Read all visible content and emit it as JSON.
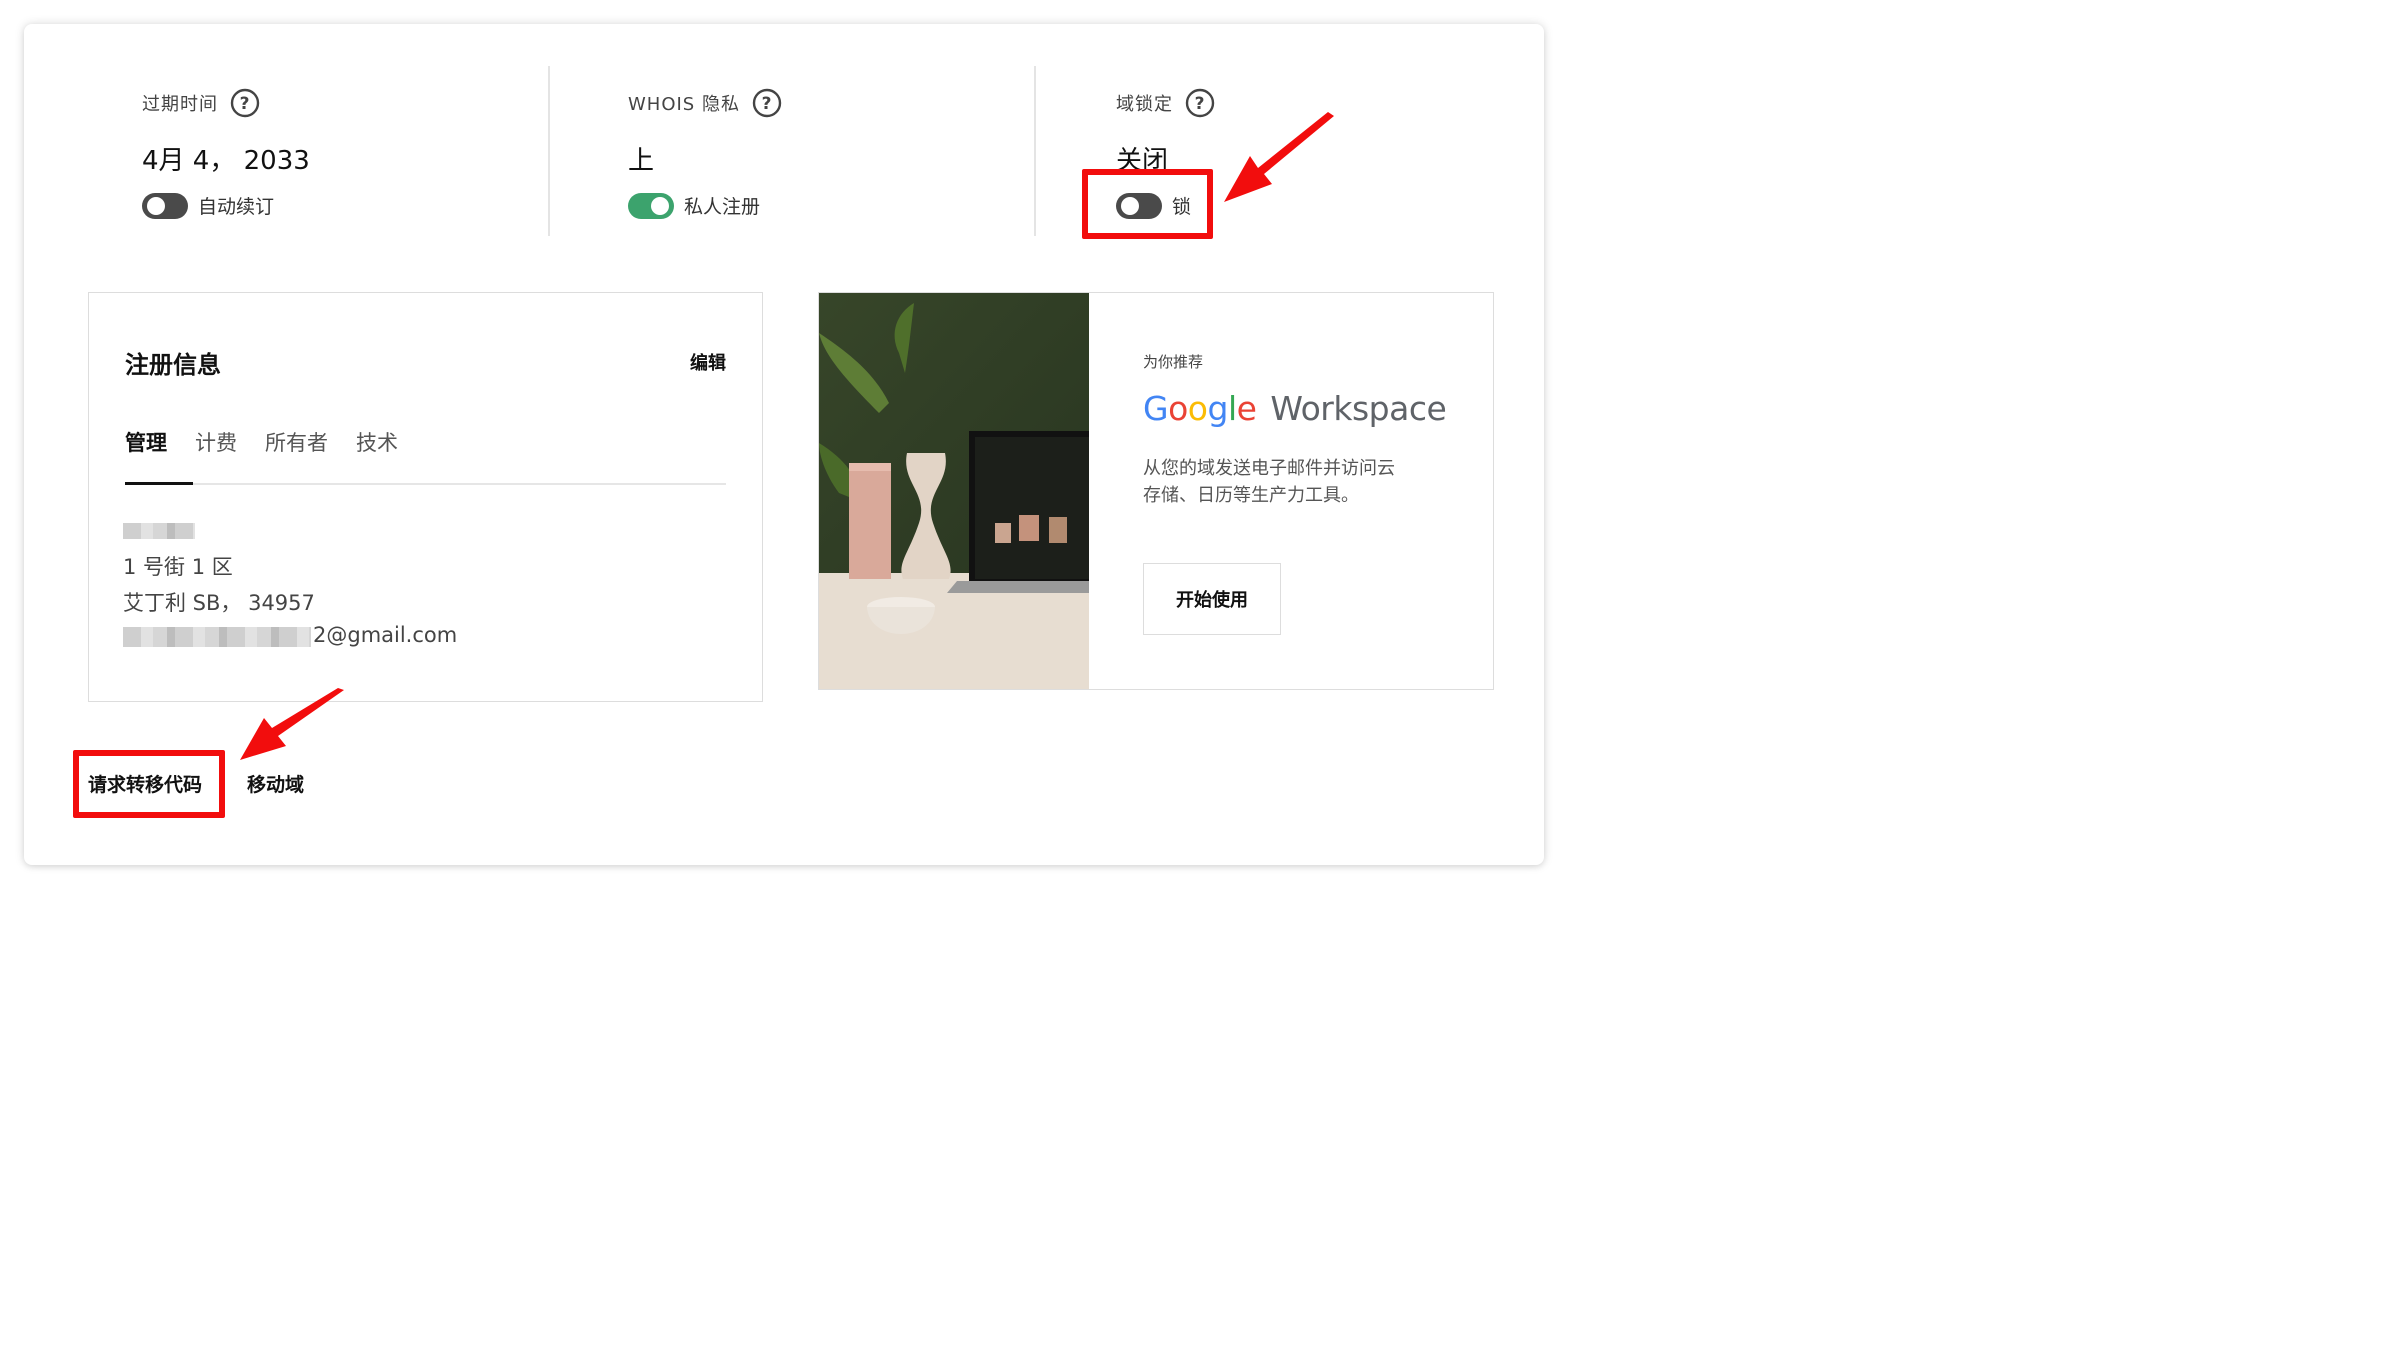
{
  "status_columns": [
    {
      "label": "过期时间",
      "value": "4月 4， 2033",
      "toggle_label": "自动续订",
      "toggle_on": false
    },
    {
      "label": "WHOIS 隐私",
      "value": "上",
      "toggle_label": "私人注册",
      "toggle_on": true
    },
    {
      "label": "域锁定",
      "value": "关闭",
      "toggle_label": "锁",
      "toggle_on": false
    }
  ],
  "registration": {
    "title": "注册信息",
    "edit_label": "编辑",
    "tabs": [
      {
        "label": "管理",
        "active": true
      },
      {
        "label": "计费",
        "active": false
      },
      {
        "label": "所有者",
        "active": false
      },
      {
        "label": "技术",
        "active": false
      }
    ],
    "address_line_1": "1 号街 1 区",
    "address_line_2": "艾丁利 SB， 34957",
    "email_suffix": "2@gmail.com"
  },
  "promo": {
    "kicker": "为你推荐",
    "brand_google": [
      "G",
      "o",
      "o",
      "g",
      "l",
      "e"
    ],
    "brand_product": "Workspace",
    "description_line_1": "从您的域发送电子邮件并访问云",
    "description_line_2": "存储、日历等生产力工具。",
    "button_label": "开始使用"
  },
  "actions": {
    "request_transfer_code": "请求转移代码",
    "move_domain": "移动域"
  },
  "colors": {
    "annotation_red": "#f20d0d",
    "toggle_on": "#3ca36d",
    "toggle_off": "#4a4a4a",
    "google_blue": "#4285F4",
    "google_red": "#EA4335",
    "google_yellow": "#FBBC05",
    "google_green": "#34A853"
  }
}
